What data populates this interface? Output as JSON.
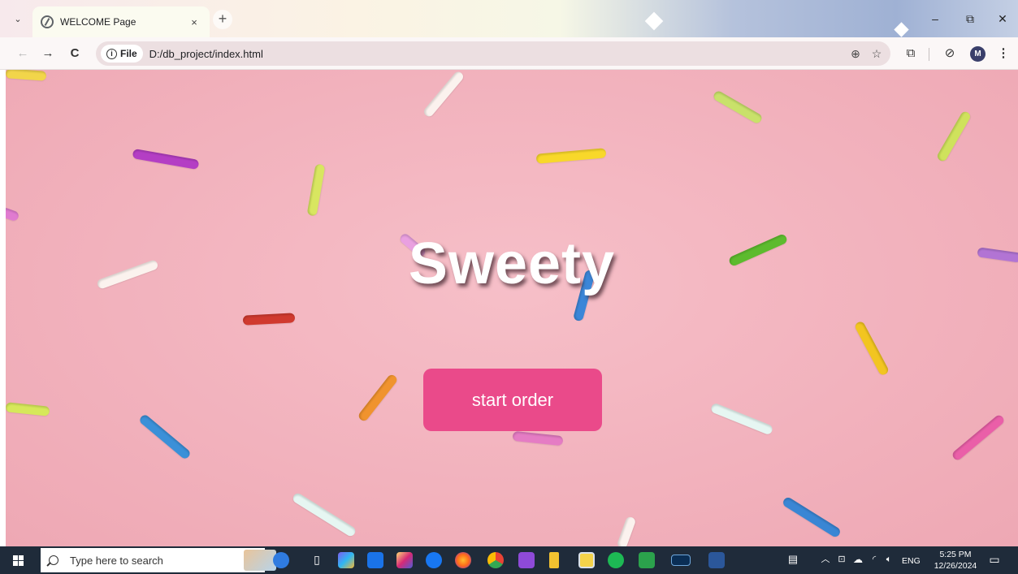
{
  "browser": {
    "tab": {
      "title": "WELCOME Page",
      "close_glyph": "×"
    },
    "new_tab_glyph": "+",
    "tab_list_glyph": "⌄",
    "window_controls": {
      "minimize": "–",
      "restore": "⧉",
      "close": "✕"
    },
    "nav": {
      "back": "←",
      "forward": "→",
      "reload": "C"
    },
    "address_bar": {
      "chip_label": "File",
      "url": "D:/db_project/index.html"
    },
    "profile_initial": "M"
  },
  "page": {
    "title": "Sweety",
    "button_label": "start order",
    "background_color": "#f2b2bd",
    "button_color": "#ea4a8a"
  },
  "taskbar": {
    "search_placeholder": "Type here to search",
    "language": "ENG",
    "time": "5:25 PM",
    "date": "12/26/2024"
  }
}
